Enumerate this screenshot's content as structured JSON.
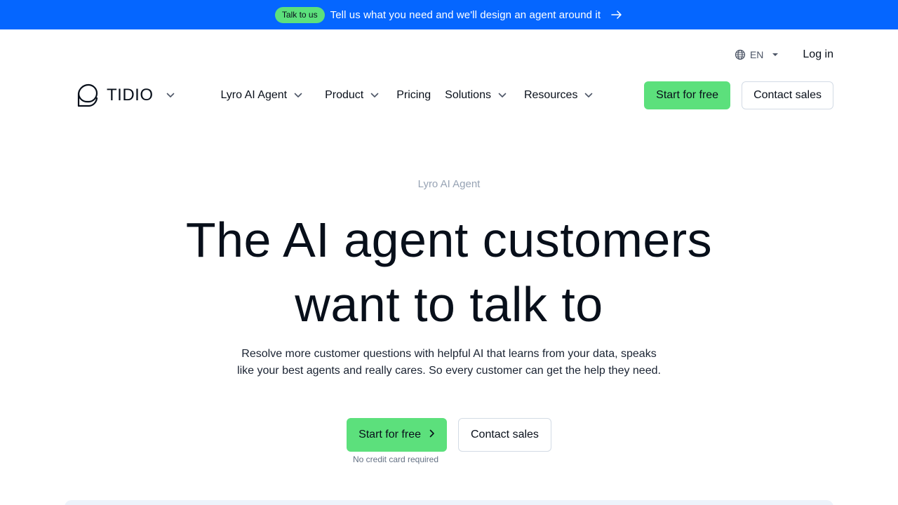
{
  "banner": {
    "pill": "Talk to us",
    "text": "Tell us what you need and we'll design an agent around it",
    "arrow_icon": "arrow-right-icon",
    "background": "#0566ff"
  },
  "utility": {
    "language": "EN",
    "login": "Log in"
  },
  "nav": {
    "logo_text": "TIDIO",
    "items": [
      {
        "label": "Lyro AI Agent",
        "dropdown": true
      },
      {
        "label": "Product",
        "dropdown": true
      },
      {
        "label": "Pricing",
        "dropdown": false
      },
      {
        "label": "Solutions",
        "dropdown": true
      },
      {
        "label": "Resources",
        "dropdown": true
      }
    ],
    "cta_primary": "Start for free",
    "cta_secondary": "Contact sales"
  },
  "hero": {
    "eyebrow": "Lyro AI Agent",
    "headline_line1": "The AI agent customers",
    "headline_line2": "want to talk to",
    "subtext_line1": "Resolve more customer questions with helpful AI that learns from your data, speaks",
    "subtext_line2": "like your best agents and really cares. So every customer can get the help they need.",
    "cta_primary": "Start for free",
    "cta_secondary": "Contact sales",
    "note": "No credit card required"
  },
  "colors": {
    "accent_green": "#5ce07c",
    "brand_blue": "#0566ff",
    "text_dark": "#080f1a"
  }
}
